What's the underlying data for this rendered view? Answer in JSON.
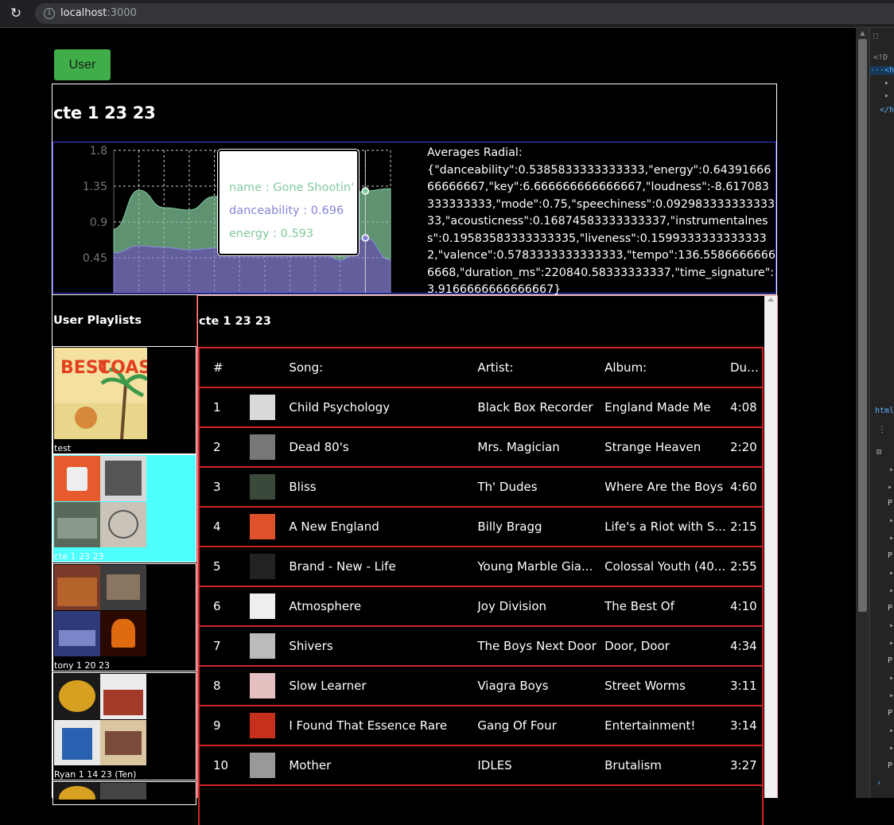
{
  "browser": {
    "url_host": "localhost",
    "url_port": ":3000"
  },
  "user_button": "User",
  "playlist_title": "cte 1 23 23",
  "averages_label": "Averages Radial:",
  "averages_json": "{\"danceability\":0.5385833333333333,\"energy\":0.6439166666666667,\"key\":6.666666666666667,\"loudness\":-8.617083333333333,\"mode\":0.75,\"speechiness\":0.09298333333333333,\"acousticness\":0.16874583333333337,\"instrumentalness\":0.19583583333333335,\"liveness\":0.15993333333333332,\"valence\":0.5783333333333333,\"tempo\":136.55866666666668,\"duration_ms\":220840.58333333337,\"time_signature\":3.9166666666666667}",
  "chart_data": {
    "type": "area",
    "yticks": [
      "1.8",
      "1.35",
      "0.9",
      "0.45"
    ],
    "ylim": [
      0,
      1.8
    ],
    "series": [
      {
        "name": "danceability",
        "color": "#8884d8",
        "values": [
          0.51,
          0.6,
          0.58,
          0.55,
          0.57,
          0.62,
          0.62,
          0.64,
          0.62,
          0.42,
          0.7,
          0.42
        ]
      },
      {
        "name": "energy",
        "color": "#82ca9d",
        "values": [
          0.3,
          0.7,
          0.5,
          0.5,
          0.65,
          0.7,
          0.75,
          0.7,
          0.7,
          0.7,
          0.59,
          0.9
        ]
      }
    ],
    "tooltip": {
      "name_line": "name : Gone Shootin'",
      "dance_line": "danceability : 0.696",
      "energy_line": "energy : 0.593"
    }
  },
  "sidebar": {
    "title": "User Playlists",
    "playlists": [
      {
        "name": "test"
      },
      {
        "name": "cte 1 23 23"
      },
      {
        "name": "tony 1 20 23"
      },
      {
        "name": "Ryan 1 14 23 (Ten)"
      }
    ]
  },
  "tracks": {
    "title": "cte 1 23 23",
    "headers": [
      "#",
      "Song:",
      "Artist:",
      "Album:",
      "Dur..."
    ],
    "rows": [
      {
        "n": "1",
        "song": "Child Psychology",
        "artist": "Black Box Recorder",
        "album": "England Made Me",
        "dur": "4:08",
        "color": "#d9d9d9"
      },
      {
        "n": "2",
        "song": "Dead 80's",
        "artist": "Mrs. Magician",
        "album": "Strange Heaven",
        "dur": "2:20",
        "color": "#777777"
      },
      {
        "n": "3",
        "song": "Bliss",
        "artist": "Th' Dudes",
        "album": "Where Are the Boys",
        "dur": "4:60",
        "color": "#3a4a3a"
      },
      {
        "n": "4",
        "song": "A New England",
        "artist": "Billy Bragg",
        "album": "Life's a Riot with S...",
        "dur": "2:15",
        "color": "#e0502a"
      },
      {
        "n": "5",
        "song": "Brand - New - Life",
        "artist": "Young Marble Gia...",
        "album": "Colossal Youth (40...",
        "dur": "2:55",
        "color": "#222222"
      },
      {
        "n": "6",
        "song": "Atmosphere",
        "artist": "Joy Division",
        "album": "The Best Of",
        "dur": "4:10",
        "color": "#eeeeee"
      },
      {
        "n": "7",
        "song": "Shivers",
        "artist": "The Boys Next Door",
        "album": "Door, Door",
        "dur": "4:34",
        "color": "#bbbbbb"
      },
      {
        "n": "8",
        "song": "Slow Learner",
        "artist": "Viagra Boys",
        "album": "Street Worms",
        "dur": "3:11",
        "color": "#e6c0c0"
      },
      {
        "n": "9",
        "song": "I Found That Essence Rare",
        "artist": "Gang Of Four",
        "album": "Entertainment!",
        "dur": "3:14",
        "color": "#c8301e"
      },
      {
        "n": "10",
        "song": "Mother",
        "artist": "IDLES",
        "album": "Brutalism",
        "dur": "3:27",
        "color": "#999999"
      }
    ]
  }
}
